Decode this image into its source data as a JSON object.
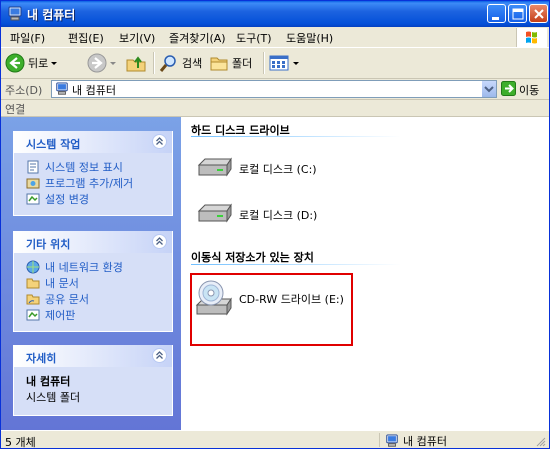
{
  "window": {
    "title": "내 컴퓨터",
    "controls": [
      "minimize",
      "maximize",
      "close"
    ]
  },
  "menu": {
    "items": [
      "파일(F)",
      "편집(E)",
      "보기(V)",
      "즐겨찾기(A)",
      "도구(T)",
      "도움말(H)"
    ]
  },
  "toolbar": {
    "back_label": "뒤로",
    "search_label": "검색",
    "folders_label": "폴더"
  },
  "address": {
    "label": "주소(D)",
    "value": "내 컴퓨터",
    "go_label": "이동"
  },
  "links": {
    "label": "연결"
  },
  "sidebar": {
    "system_tasks": {
      "title": "시스템 작업",
      "items": [
        "시스템 정보 표시",
        "프로그램 추가/제거",
        "설정 변경"
      ]
    },
    "other_places": {
      "title": "기타 위치",
      "items": [
        "내 네트워크 환경",
        "내 문서",
        "공유 문서",
        "제어판"
      ]
    },
    "details": {
      "title": "자세히",
      "name": "내 컴퓨터",
      "type": "시스템 폴더"
    }
  },
  "content": {
    "hard_drives_title": "하드 디스크 드라이브",
    "hard_drives": [
      "로컬 디스크 (C:)",
      "로컬 디스크 (D:)"
    ],
    "removable_title": "이동식 저장소가 있는 장치",
    "removable": [
      "CD-RW 드라이브 (E:)"
    ]
  },
  "status": {
    "count": "5 개체",
    "location": "내 컴퓨터"
  },
  "colors": {
    "titlebar": "#0A5FE3",
    "sidebar_link": "#215DC6",
    "highlight_box": "#E00000"
  }
}
